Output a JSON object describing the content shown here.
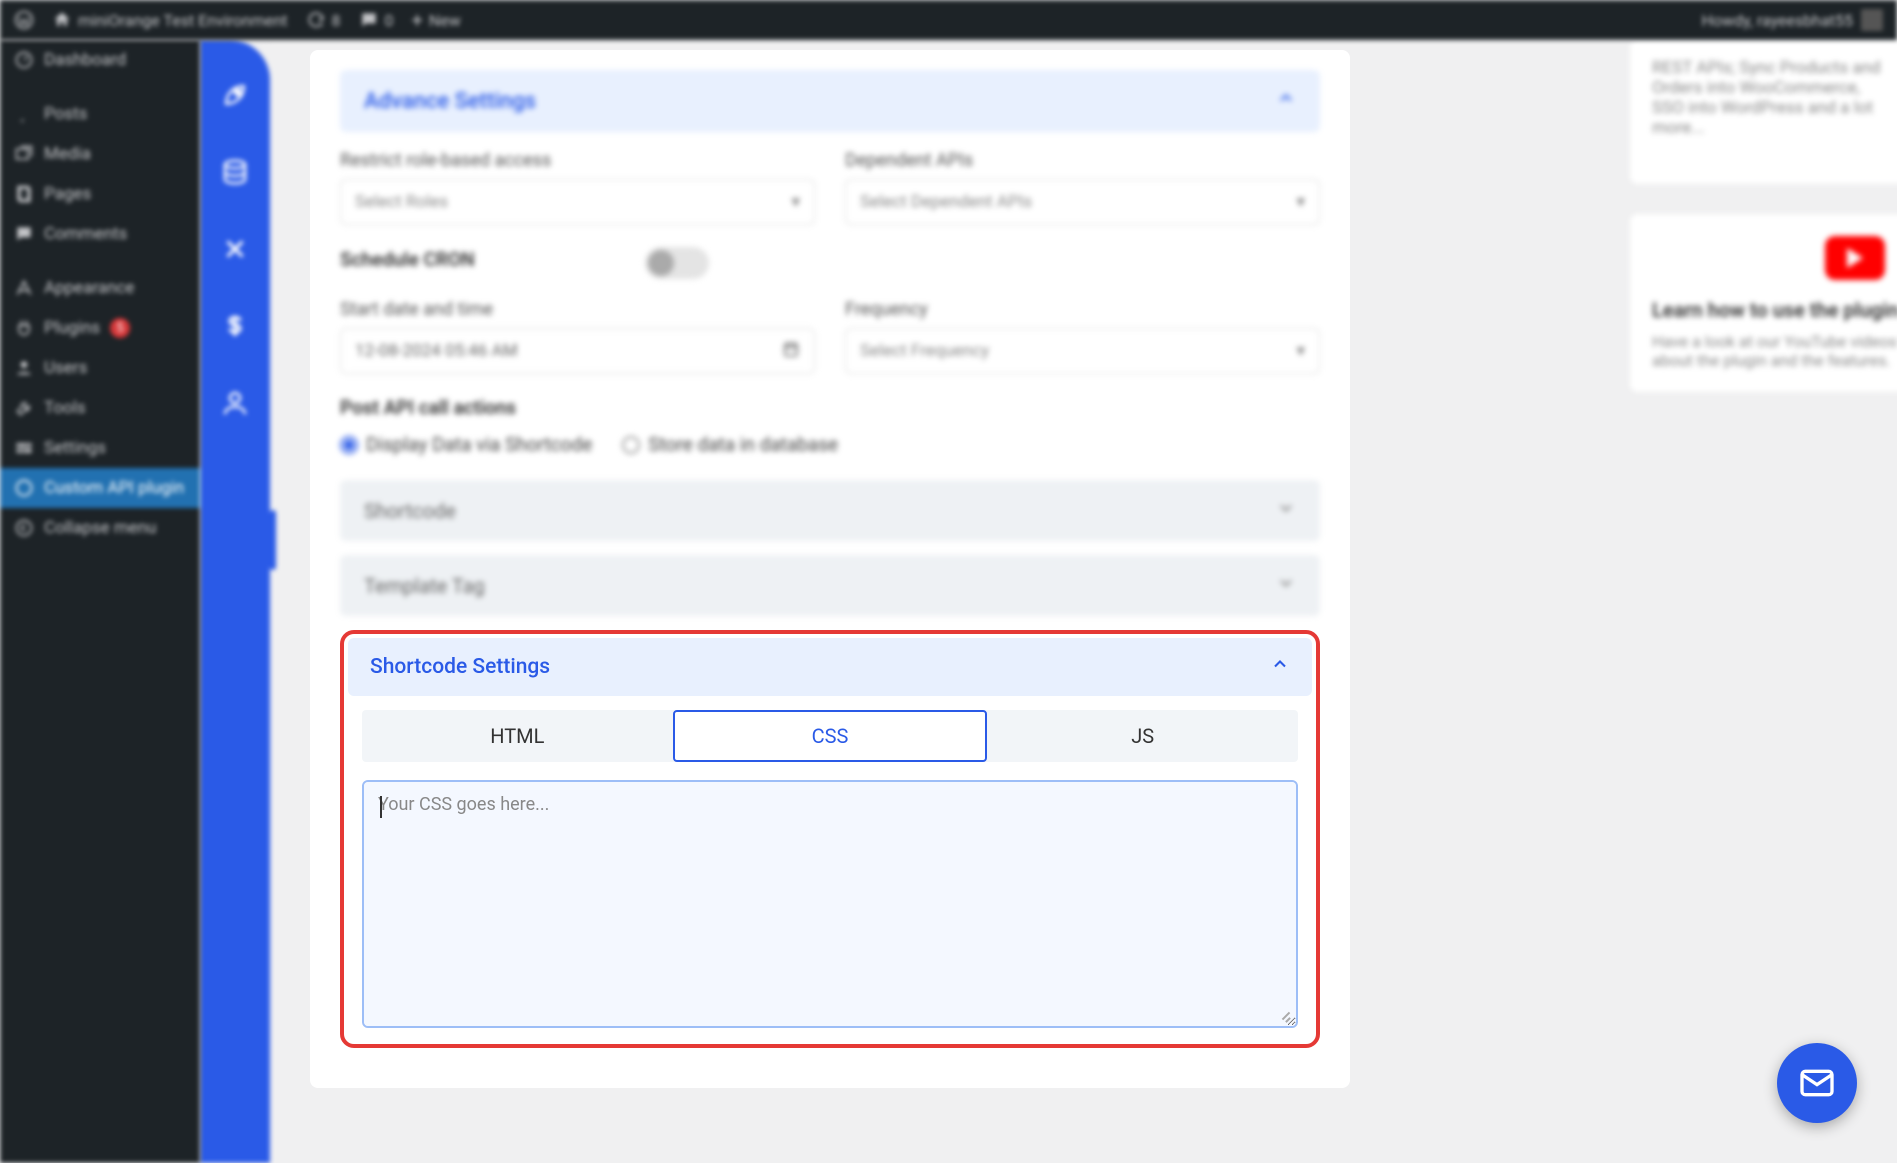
{
  "adminbar": {
    "site_name": "miniOrange Test Environment",
    "updates_count": "8",
    "comments_count": "0",
    "new_label": "New",
    "howdy": "Howdy, rayeesbhat55"
  },
  "sidebar": {
    "items": [
      {
        "label": "Dashboard",
        "icon": "dashboard-icon"
      },
      {
        "label": "Posts",
        "icon": "pin-icon"
      },
      {
        "label": "Media",
        "icon": "media-icon"
      },
      {
        "label": "Pages",
        "icon": "pages-icon"
      },
      {
        "label": "Comments",
        "icon": "comments-icon"
      },
      {
        "label": "Appearance",
        "icon": "appearance-icon"
      },
      {
        "label": "Plugins",
        "icon": "plugins-icon",
        "badge": "5"
      },
      {
        "label": "Users",
        "icon": "users-icon"
      },
      {
        "label": "Tools",
        "icon": "tools-icon"
      },
      {
        "label": "Settings",
        "icon": "settings-icon"
      },
      {
        "label": "Custom API plugin",
        "icon": "api-icon",
        "active": true
      },
      {
        "label": "Collapse menu",
        "icon": "collapse-icon"
      }
    ]
  },
  "plugin_rail": {
    "icons": [
      "rocket-icon",
      "database-icon",
      "tools-icon",
      "dollar-icon",
      "user-icon"
    ]
  },
  "advance_settings": {
    "title": "Advance Settings",
    "restrict_label": "Restrict role-based access",
    "restrict_placeholder": "Select Roles",
    "dependent_label": "Dependent APIs",
    "dependent_placeholder": "Select Dependent APIs",
    "schedule_cron_label": "Schedule CRON",
    "start_label": "Start date and time",
    "start_value": "12-08-2024 05:46 AM",
    "frequency_label": "Frequency",
    "frequency_placeholder": "Select Frequency",
    "post_actions_label": "Post API call actions",
    "radio_shortcode": "Display Data via Shortcode",
    "radio_database": "Store data in database",
    "shortcode_accordion": "Shortcode",
    "template_accordion": "Template Tag"
  },
  "shortcode_settings": {
    "title": "Shortcode Settings",
    "tabs": {
      "html": "HTML",
      "css": "CSS",
      "js": "JS"
    },
    "active_tab": "css",
    "css_placeholder": "Your CSS goes here..."
  },
  "right": {
    "promo_text": "REST APIs; Sync Products and Orders into WooCommerce, SSO into WordPress and a lot more...",
    "youtube_title": "Learn how to use the plugin on YouTube",
    "youtube_desc": "Have a look at our YouTube videos to understand more about the plugin and the features."
  }
}
